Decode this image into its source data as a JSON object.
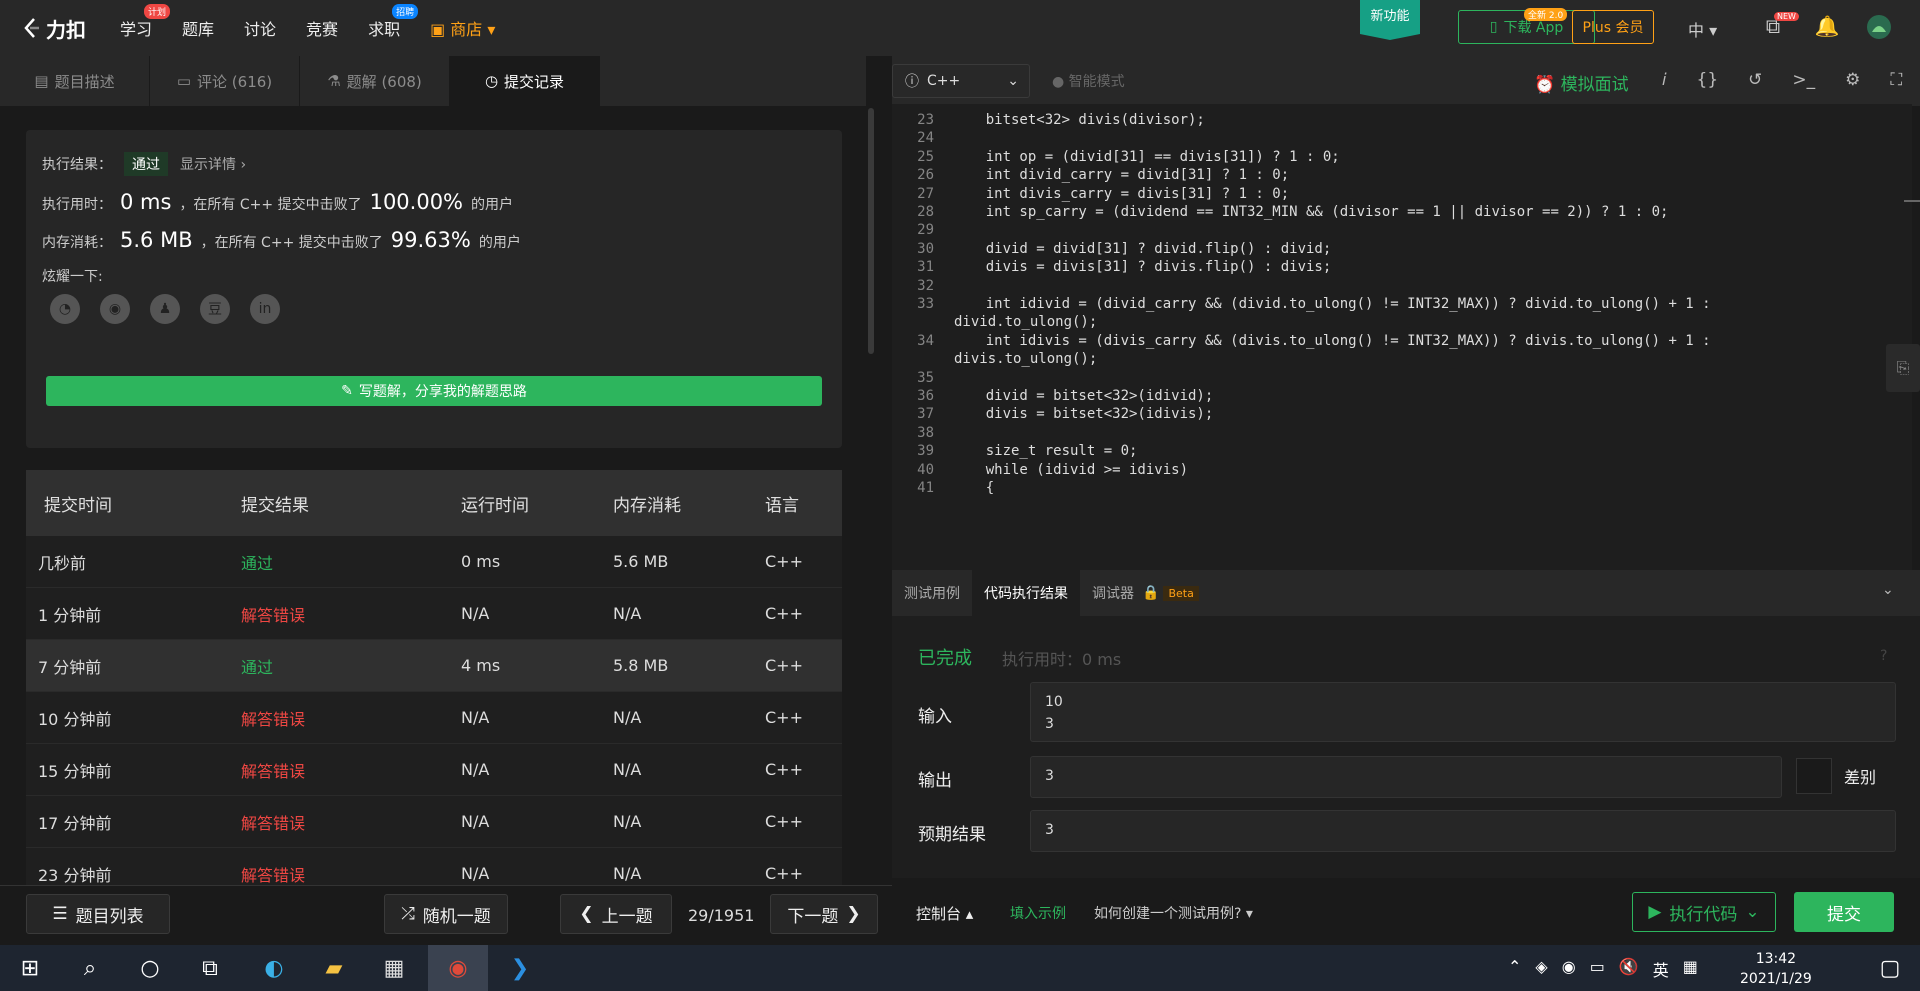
{
  "nav": {
    "logo": "力扣",
    "items": [
      {
        "label": "学习",
        "badge": "计划",
        "badge_color": "#ef4743"
      },
      {
        "label": "题库"
      },
      {
        "label": "讨论"
      },
      {
        "label": "竞赛"
      },
      {
        "label": "求职",
        "badge": "招聘",
        "badge_color": "#0a84ff"
      },
      {
        "label": "商店",
        "accent": "#ffa116"
      }
    ],
    "new_feature": "新功能",
    "download_app": "下载 App",
    "download_badge": "全新 2.0",
    "plus": "Plus 会员",
    "lang": "中",
    "new_badge": "NEW"
  },
  "left_tabs": [
    {
      "label": "题目描述",
      "icon": "doc-icon"
    },
    {
      "label": "评论 (616)",
      "icon": "comment-icon"
    },
    {
      "label": "题解 (608)",
      "icon": "flask-icon"
    },
    {
      "label": "提交记录",
      "icon": "clock-icon"
    }
  ],
  "result": {
    "label": "执行结果：",
    "status": "通过",
    "detail": "显示详情 ›",
    "time_label": "执行用时：",
    "time_value": "0 ms",
    "time_mid": "，在所有 C++ 提交中击败了",
    "time_pct": "100.00%",
    "time_suffix": "的用户",
    "mem_label": "内存消耗：",
    "mem_value": "5.6 MB",
    "mem_mid": "，在所有 C++ 提交中击败了",
    "mem_pct": "99.63%",
    "mem_suffix": "的用户",
    "share_label": "炫耀一下:",
    "share_icons": [
      "wechat-icon",
      "weibo-icon",
      "qq-icon",
      "douban-icon",
      "linkedin-icon"
    ],
    "write_btn": "写题解，分享我的解题思路"
  },
  "table": {
    "headers": [
      "提交时间",
      "提交结果",
      "运行时间",
      "内存消耗",
      "语言"
    ],
    "rows": [
      {
        "time": "几秒前",
        "result": "通过",
        "ok": true,
        "runtime": "0 ms",
        "mem": "5.6 MB",
        "lang": "C++"
      },
      {
        "time": "1 分钟前",
        "result": "解答错误",
        "ok": false,
        "runtime": "N/A",
        "mem": "N/A",
        "lang": "C++"
      },
      {
        "time": "7 分钟前",
        "result": "通过",
        "ok": true,
        "runtime": "4 ms",
        "mem": "5.8 MB",
        "lang": "C++"
      },
      {
        "time": "10 分钟前",
        "result": "解答错误",
        "ok": false,
        "runtime": "N/A",
        "mem": "N/A",
        "lang": "C++"
      },
      {
        "time": "15 分钟前",
        "result": "解答错误",
        "ok": false,
        "runtime": "N/A",
        "mem": "N/A",
        "lang": "C++"
      },
      {
        "time": "17 分钟前",
        "result": "解答错误",
        "ok": false,
        "runtime": "N/A",
        "mem": "N/A",
        "lang": "C++"
      },
      {
        "time": "23 分钟前",
        "result": "解答错误",
        "ok": false,
        "runtime": "N/A",
        "mem": "N/A",
        "lang": "C++"
      }
    ]
  },
  "bottom": {
    "problem_list": "题目列表",
    "random": "随机一题",
    "prev": "上一题",
    "page": "29/1951",
    "next": "下一题"
  },
  "editor": {
    "language": "C++",
    "smart_mode": "智能模式",
    "mock_interview": "模拟面试",
    "lines": [
      {
        "n": "23",
        "code": "    bitset<32> divis(divisor);"
      },
      {
        "n": "24",
        "code": ""
      },
      {
        "n": "25",
        "code": "    int op = (divid[31] == divis[31]) ? 1 : 0;"
      },
      {
        "n": "26",
        "code": "    int divid_carry = divid[31] ? 1 : 0;"
      },
      {
        "n": "27",
        "code": "    int divis_carry = divis[31] ? 1 : 0;"
      },
      {
        "n": "28",
        "code": "    int sp_carry = (dividend == INT32_MIN && (divisor == 1 || divisor == 2)) ? 1 : 0;"
      },
      {
        "n": "29",
        "code": ""
      },
      {
        "n": "30",
        "code": "    divid = divid[31] ? divid.flip() : divid;"
      },
      {
        "n": "31",
        "code": "    divis = divis[31] ? divis.flip() : divis;"
      },
      {
        "n": "32",
        "code": ""
      },
      {
        "n": "33",
        "code": "    int idivid = (divid_carry && (divid.to_ulong() != INT32_MAX)) ? divid.to_ulong() + 1 :"
      },
      {
        "n": "",
        "code": "divid.to_ulong();"
      },
      {
        "n": "34",
        "code": "    int idivis = (divis_carry && (divis.to_ulong() != INT32_MAX)) ? divis.to_ulong() + 1 :"
      },
      {
        "n": "",
        "code": "divis.to_ulong();"
      },
      {
        "n": "35",
        "code": ""
      },
      {
        "n": "36",
        "code": "    divid = bitset<32>(idivid);"
      },
      {
        "n": "37",
        "code": "    divis = bitset<32>(idivis);"
      },
      {
        "n": "38",
        "code": ""
      },
      {
        "n": "39",
        "code": "    size_t result = 0;"
      },
      {
        "n": "40",
        "code": "    while (idivid >= idivis)"
      },
      {
        "n": "41",
        "code": "    {"
      }
    ]
  },
  "console": {
    "tabs": [
      "测试用例",
      "代码执行结果",
      "调试器"
    ],
    "beta": "Beta",
    "status": "已完成",
    "exec_time": "执行用时：0 ms",
    "input_label": "输入",
    "input_value": "10\n3",
    "output_label": "输出",
    "output_value": "3",
    "diff": "差别",
    "expected_label": "预期结果",
    "expected_value": "3",
    "console_btn": "控制台",
    "fill_example": "填入示例",
    "how_to": "如何创建一个测试用例?",
    "run": "执行代码",
    "submit": "提交"
  },
  "taskbar": {
    "ime": "英",
    "time": "13:42",
    "date": "2021/1/29"
  }
}
